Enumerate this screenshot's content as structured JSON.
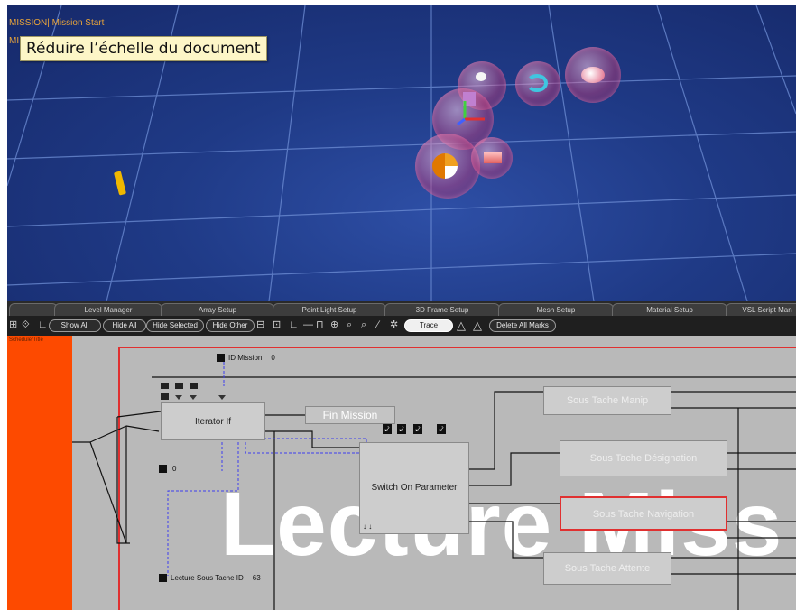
{
  "viewport": {
    "label_line1": "MISSION| Mission Start",
    "label_line2": "MI",
    "tooltip": "Réduire l’échelle du document"
  },
  "tabs": [
    "",
    "Level Manager",
    "Array Setup",
    "Point Light Setup",
    "3D Frame Setup",
    "Mesh Setup",
    "Material Setup",
    "VSL Script Man"
  ],
  "toolbar": {
    "show_all": "Show All",
    "hide_all": "Hide All",
    "hide_selected": "Hide Selected",
    "hide_other": "Hide Other",
    "trace": "Trace",
    "delete_all_marks": "Delete All Marks"
  },
  "schematic": {
    "orange_label": "Schedule/Title",
    "watermark": "Lecture Miss",
    "params": {
      "id_mission_label": "ID Mission",
      "id_mission_value": "0",
      "iterator_param_value": "0",
      "lecture_label": "Lecture Sous Tache ID",
      "lecture_value": "63"
    },
    "blocks": {
      "iterator": "Iterator If",
      "fin_mission": "Fin Mission",
      "switch": "Switch On Parameter",
      "switch_footer": "↓ ↓",
      "manip": "Sous Tache Manip",
      "designation": "Sous Tache Désignation",
      "navigation": "Sous Tache Navigation",
      "attente": "Sous Tache Attente"
    }
  }
}
